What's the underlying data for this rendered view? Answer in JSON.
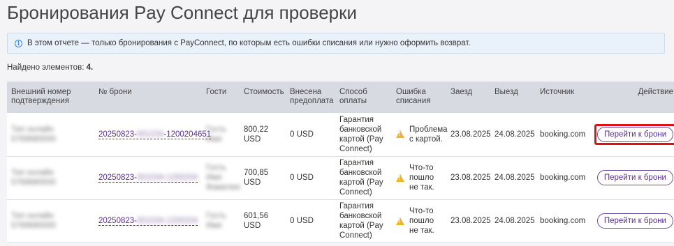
{
  "page": {
    "title": "Бронирования Pay Connect для проверки",
    "info_text": "В этом отчете — только бронирования с PayConnect, по которым есть ошибки списания или нужно оформить возврат.",
    "found_label": "Найдено элементов:",
    "found_count": "4."
  },
  "table": {
    "columns": [
      "Внешний номер подтверждения",
      "№ брони",
      "Гости",
      "Стоимость",
      "Внесена предоплата",
      "Способ оплаты",
      "Ошибка списания",
      "Заезд",
      "Выезд",
      "Источник",
      "Действие"
    ],
    "rows": [
      {
        "external": "Тип онлайн 5769680000",
        "booking_prefix": "20250823-",
        "booking_hidden": "001234",
        "booking_suffix": "-1200204651",
        "guests": "Гость Имя",
        "cost": "800,22 USD",
        "prepaid": "0 USD",
        "payment": "Гарантия банковской картой (Pay Connect)",
        "error": "Проблема с картой.",
        "error_icon": "warning-icon",
        "checkin": "23.08.2025",
        "checkout": "24.08.2025",
        "source": "booking.com",
        "action": "Перейти к брони"
      },
      {
        "external": "Тип онлайн 5769680000",
        "booking_prefix": "20250823-",
        "booking_hidden": "001034-1200204",
        "booking_suffix": "",
        "guests": "Гость Имя Фамилия",
        "cost": "700,85 USD",
        "prepaid": "0 USD",
        "payment": "Гарантия банковской картой (Pay Connect)",
        "error": "Что-то пошло не так.",
        "error_icon": "warning-icon",
        "checkin": "23.08.2025",
        "checkout": "24.08.2025",
        "source": "booking.com",
        "action": "Перейти к брони"
      },
      {
        "external": "Тип онлайн 5769680000",
        "booking_prefix": "20250823-",
        "booking_hidden": "001034-1200204",
        "booking_suffix": "",
        "guests": "Гость Имя",
        "cost": "601,56 USD",
        "prepaid": "0 USD",
        "payment": "Гарантия банковской картой (Pay Connect)",
        "error": "Что-то пошло не так.",
        "error_icon": "warning-icon",
        "checkin": "23.08.2025",
        "checkout": "24.08.2025",
        "source": "booking.com",
        "action": "Перейти к брони"
      }
    ]
  },
  "colors": {
    "accent": "#5c2e91",
    "warning": "#f0b429",
    "highlight": "#e01010",
    "info_bg": "#e9f2fb"
  }
}
